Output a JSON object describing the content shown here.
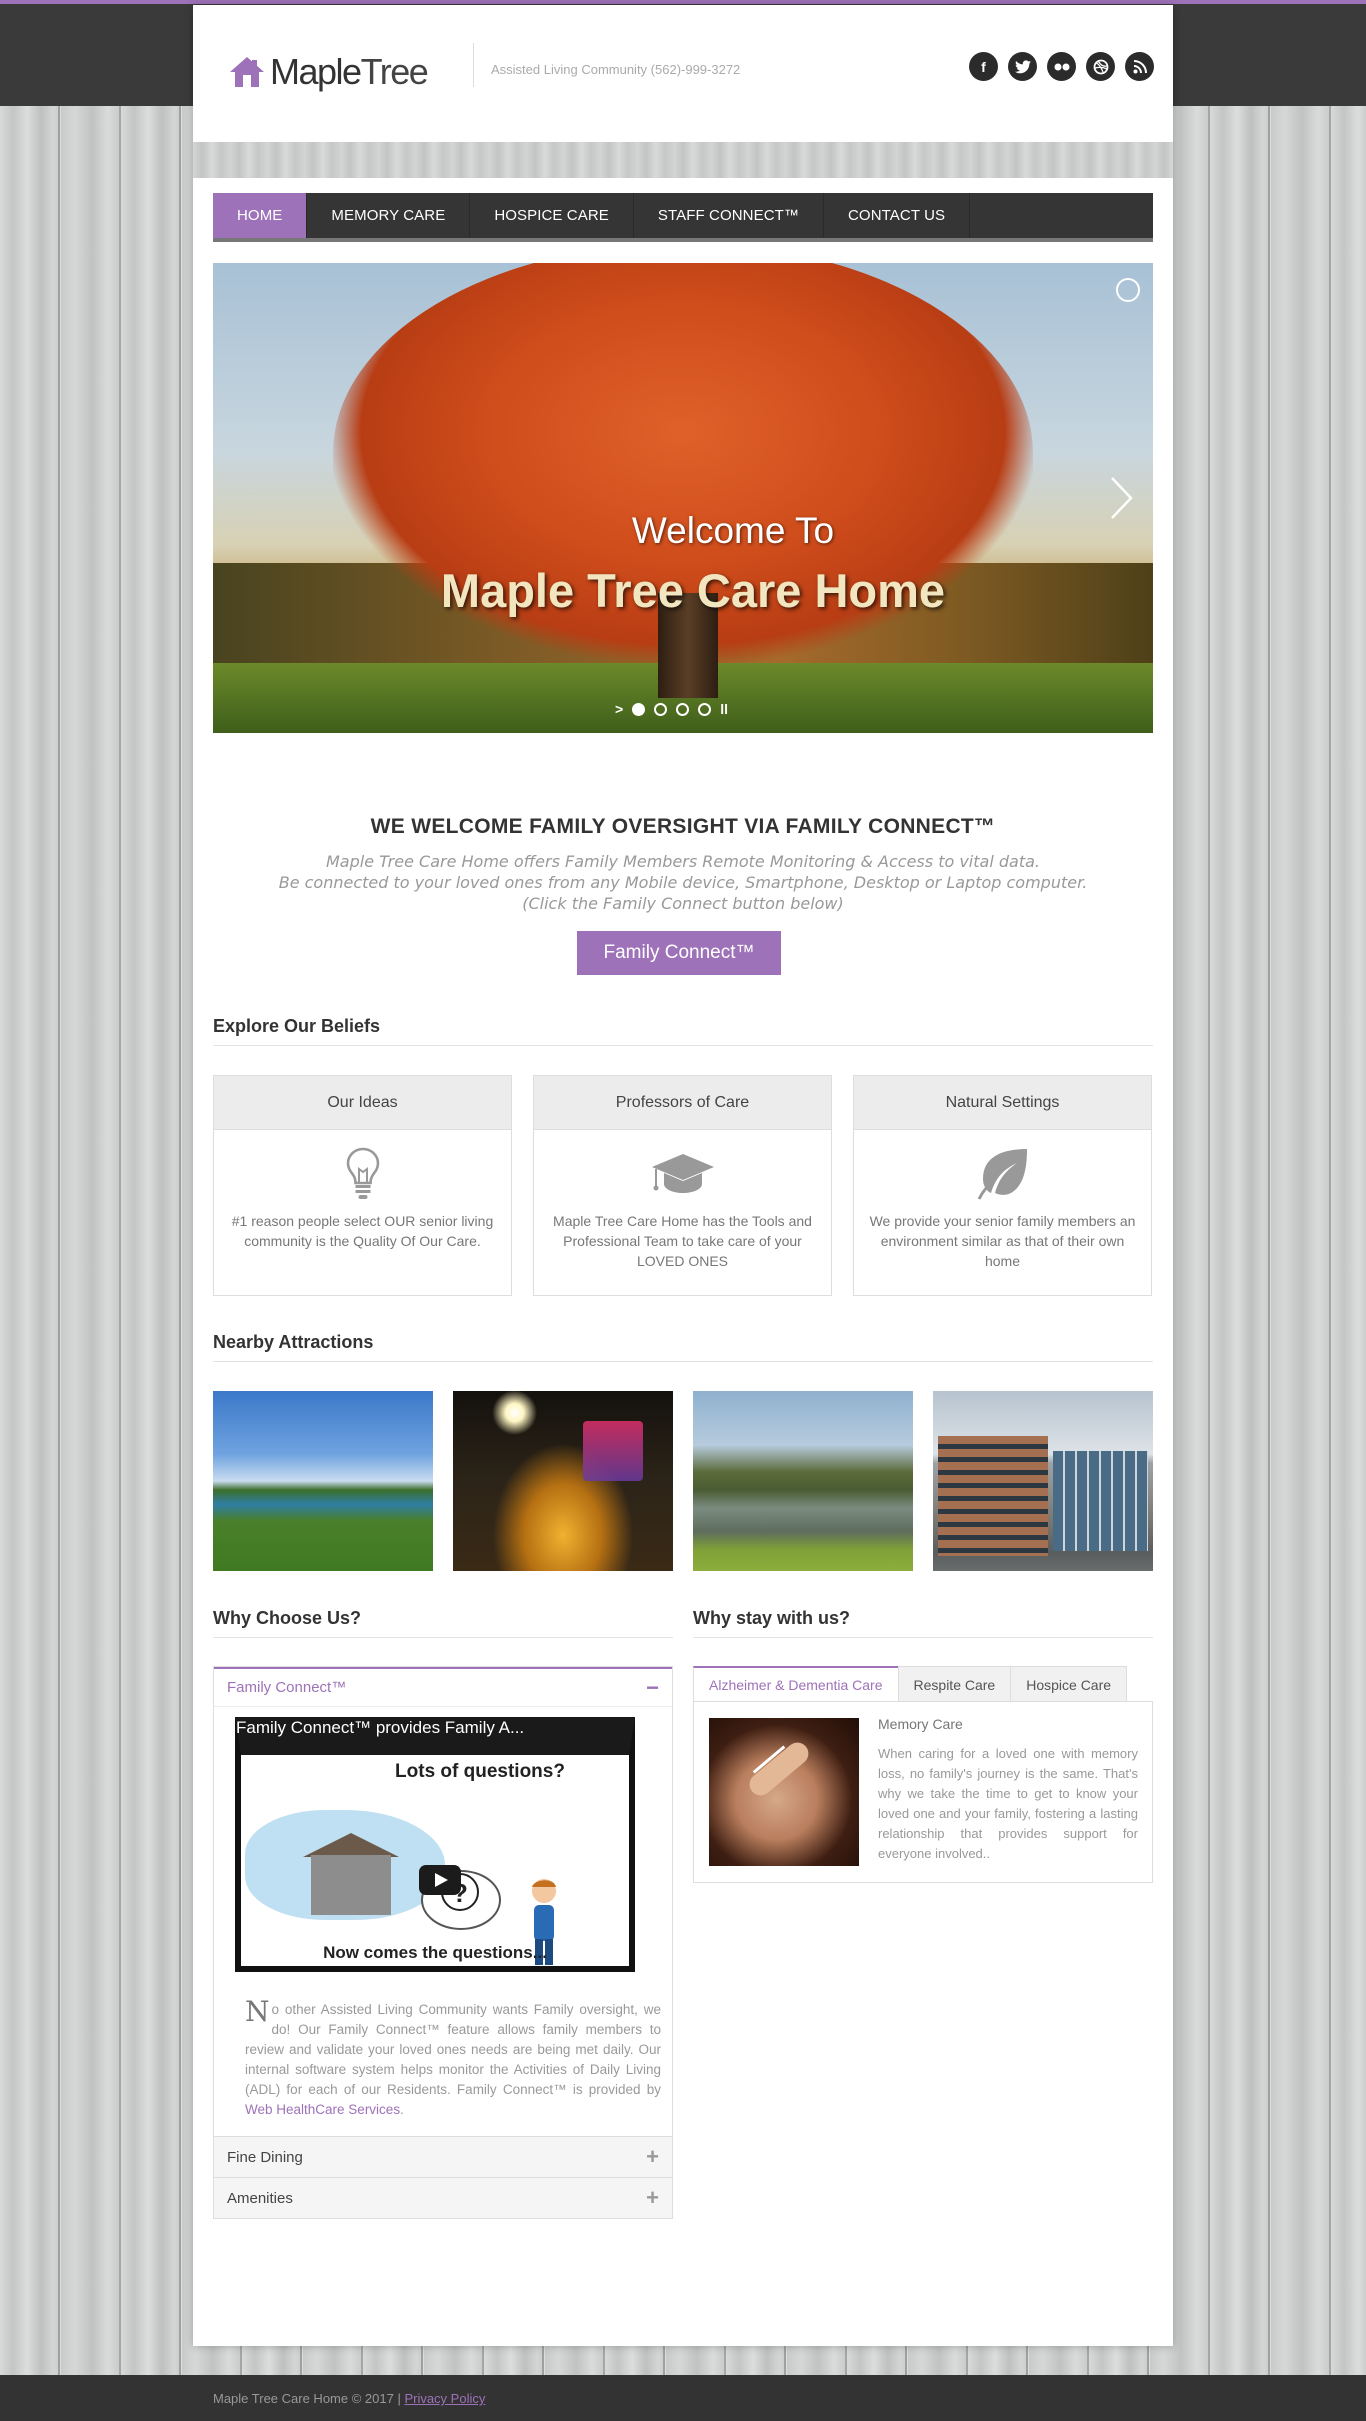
{
  "brand": {
    "name_part1": "Maple",
    "name_part2": "Tree",
    "tagline": "Assisted Living Community (562)-999-3272"
  },
  "social": [
    {
      "icon": "facebook-icon",
      "glyph": "f"
    },
    {
      "icon": "twitter-icon",
      "glyph": "t"
    },
    {
      "icon": "flickr-icon",
      "glyph": "••"
    },
    {
      "icon": "dribbble-icon",
      "glyph": "◍"
    },
    {
      "icon": "rss-icon",
      "glyph": ")"
    }
  ],
  "nav": {
    "items": [
      "HOME",
      "MEMORY CARE",
      "HOSPICE CARE",
      "STAFF CONNECT™",
      "CONTACT US"
    ],
    "active": 0
  },
  "slider": {
    "welcome": "Welcome To",
    "title": "Maple Tree Care Home",
    "slide_count": 5,
    "active_slide": 0
  },
  "welcome": {
    "heading": "WE WELCOME FAMILY OVERSIGHT VIA FAMILY CONNECT™",
    "line1": "Maple Tree Care Home offers Family Members Remote Monitoring & Access to vital data.",
    "line2": "Be connected to your loved ones from any Mobile device, Smartphone, Desktop or Laptop computer.",
    "line3": "(Click the Family Connect button below)",
    "button": "Family Connect™"
  },
  "beliefs": {
    "title": "Explore Our Beliefs",
    "cards": [
      {
        "heading": "Our Ideas",
        "icon": "lightbulb-icon",
        "text": "#1 reason people select OUR senior living community is the Quality Of Our Care."
      },
      {
        "heading": "Professors of Care",
        "icon": "graduation-cap-icon",
        "text": "Maple Tree Care Home has the Tools and Professional Team to take care of your LOVED ONES"
      },
      {
        "heading": "Natural Settings",
        "icon": "leaf-icon",
        "text": "We provide your senior family members an environment similar as that of their own home"
      }
    ]
  },
  "attractions": {
    "title": "Nearby Attractions"
  },
  "why_choose": {
    "title": "Why Choose Us?",
    "items": [
      {
        "label": "Family Connect™",
        "open": true
      },
      {
        "label": "Fine Dining",
        "open": false
      },
      {
        "label": "Amenities",
        "open": false
      }
    ],
    "video": {
      "title": "Family Connect™ provides Family A...",
      "caption_top": "Lots of questions?",
      "caption_bottom": "Now comes the questions..."
    },
    "text_cap": "N",
    "text_body": "o other Assisted Living Community wants Family oversight, we do! Our Family Connect™ feature allows family members to review and validate your loved ones needs are being met daily. Our internal software system helps monitor the Activities of Daily Living (ADL) for each of our Residents. Family Connect™ is provided by ",
    "text_link": "Web HealthCare Services",
    "text_end": "."
  },
  "why_stay": {
    "title": "Why stay with us?",
    "tabs": [
      "Alzheimer & Dementia Care",
      "Respite Care",
      "Hospice Care"
    ],
    "active_tab": 0,
    "content_title": "Memory Care",
    "content_text": "When caring for a loved one with memory loss, no family's journey is the same. That's why we take the time to get to know your loved one and your family, fostering a lasting relationship that provides support for everyone involved.."
  },
  "footer": {
    "text": "Maple Tree Care Home  ©  2017  |  ",
    "link": "Privacy Policy"
  },
  "colors": {
    "accent": "#9e72b8",
    "nav_bg": "#353535",
    "topbar": "#3a3a3a"
  }
}
